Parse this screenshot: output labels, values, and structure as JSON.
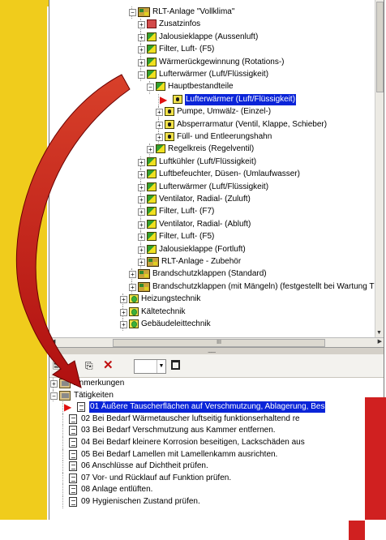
{
  "tree_top": [
    {
      "label": "RLT-Anlage \"Vollklima\"",
      "indent": 2,
      "icon": "sys",
      "exp": "-"
    },
    {
      "label": "Zusatzinfos",
      "indent": 3,
      "icon": "red",
      "exp": "+"
    },
    {
      "label": "Jalousieklappe (Aussenluft)",
      "indent": 3,
      "icon": "gy",
      "exp": "+"
    },
    {
      "label": "Filter, Luft- (F5)",
      "indent": 3,
      "icon": "gy",
      "exp": "+"
    },
    {
      "label": "Wärmerückgewinnung (Rotations-)",
      "indent": 3,
      "icon": "gy",
      "exp": "+"
    },
    {
      "label": "Lufterwärmer (Luft/Flüssigkeit)",
      "indent": 3,
      "icon": "gy",
      "exp": "-"
    },
    {
      "label": "Hauptbestandteile",
      "indent": 4,
      "icon": "gy",
      "exp": "-"
    },
    {
      "label": "Lufterwärmer (Luft/Flüssigkeit)",
      "indent": 5,
      "icon": "y",
      "exp": "",
      "selected": true,
      "marker": true
    },
    {
      "label": "Pumpe, Umwälz- (Einzel-)",
      "indent": 5,
      "icon": "y",
      "exp": "+"
    },
    {
      "label": "Absperrarmatur (Ventil, Klappe, Schieber)",
      "indent": 5,
      "icon": "y",
      "exp": "+"
    },
    {
      "label": "Füll- und Entleerungshahn",
      "indent": 5,
      "icon": "y",
      "exp": "+"
    },
    {
      "label": "Regelkreis (Regelventil)",
      "indent": 4,
      "icon": "gy",
      "exp": "+"
    },
    {
      "label": "Luftkühler (Luft/Flüssigkeit)",
      "indent": 3,
      "icon": "gy",
      "exp": "+"
    },
    {
      "label": "Luftbefeuchter, Düsen- (Umlaufwasser)",
      "indent": 3,
      "icon": "gy",
      "exp": "+"
    },
    {
      "label": "Lufterwärmer (Luft/Flüssigkeit)",
      "indent": 3,
      "icon": "gy",
      "exp": "+"
    },
    {
      "label": "Ventilator, Radial- (Zuluft)",
      "indent": 3,
      "icon": "gy",
      "exp": "+"
    },
    {
      "label": "Filter, Luft- (F7)",
      "indent": 3,
      "icon": "gy",
      "exp": "+"
    },
    {
      "label": "Ventilator, Radial- (Abluft)",
      "indent": 3,
      "icon": "gy",
      "exp": "+"
    },
    {
      "label": "Filter, Luft- (F5)",
      "indent": 3,
      "icon": "gy",
      "exp": "+"
    },
    {
      "label": "Jalousieklappe (Fortluft)",
      "indent": 3,
      "icon": "gy",
      "exp": "+"
    },
    {
      "label": "RLT-Anlage - Zubehör",
      "indent": 3,
      "icon": "sys",
      "exp": "+"
    },
    {
      "label": "Brandschutzklappen (Standard)",
      "indent": 2,
      "icon": "sys",
      "exp": "+"
    },
    {
      "label": "Brandschutzklappen (mit Mängeln) (festgestellt bei Wartung T",
      "indent": 2,
      "icon": "sys",
      "exp": "+"
    },
    {
      "label": "Heizungstechnik",
      "indent": 1,
      "icon": "ring",
      "exp": "+"
    },
    {
      "label": "Kältetechnik",
      "indent": 1,
      "icon": "ring",
      "exp": "+"
    },
    {
      "label": "Gebäudeleittechnik",
      "indent": 1,
      "icon": "ring",
      "exp": "+"
    }
  ],
  "hscroll_grip": "III",
  "splitter_grip": "..........",
  "toolbar": {
    "add_icon": "add-item-icon",
    "copy_icon": "copy-icon",
    "delete_icon": "delete-x-icon",
    "combo_value": ""
  },
  "tree_bottom": [
    {
      "label": "Anmerkungen",
      "indent": 0,
      "icon": "fold",
      "exp": "+"
    },
    {
      "label": "Tätigkeiten",
      "indent": 0,
      "icon": "fold",
      "exp": "-"
    },
    {
      "label": "01 Äußere Tauscherflächen auf Verschmutzung, Ablagerung, Bes",
      "indent": 1,
      "icon": "doc",
      "selected": true,
      "marker": true
    },
    {
      "label": "02 Bei Bedarf Wärmetauscher luftseitig funktionserhaltend re",
      "indent": 1,
      "icon": "doc"
    },
    {
      "label": "03 Bei Bedarf Verschmutzung aus Kammer entfernen.",
      "indent": 1,
      "icon": "doc"
    },
    {
      "label": "04 Bei Bedarf kleinere Korrosion beseitigen, Lackschäden aus",
      "indent": 1,
      "icon": "doc"
    },
    {
      "label": "05 Bei Bedarf Lamellen mit Lamellenkamm ausrichten.",
      "indent": 1,
      "icon": "doc"
    },
    {
      "label": "06 Anschlüsse auf Dichtheit prüfen.",
      "indent": 1,
      "icon": "doc"
    },
    {
      "label": "07 Vor- und Rücklauf auf Funktion prüfen.",
      "indent": 1,
      "icon": "doc"
    },
    {
      "label": "08 Anlage entlüften.",
      "indent": 1,
      "icon": "doc"
    },
    {
      "label": "09 Hygienischen Zustand prüfen.",
      "indent": 1,
      "icon": "doc"
    }
  ],
  "colors": {
    "accent_yellow": "#f0cc1c",
    "selection": "#0a24d8",
    "annotation_red": "#d02020"
  }
}
